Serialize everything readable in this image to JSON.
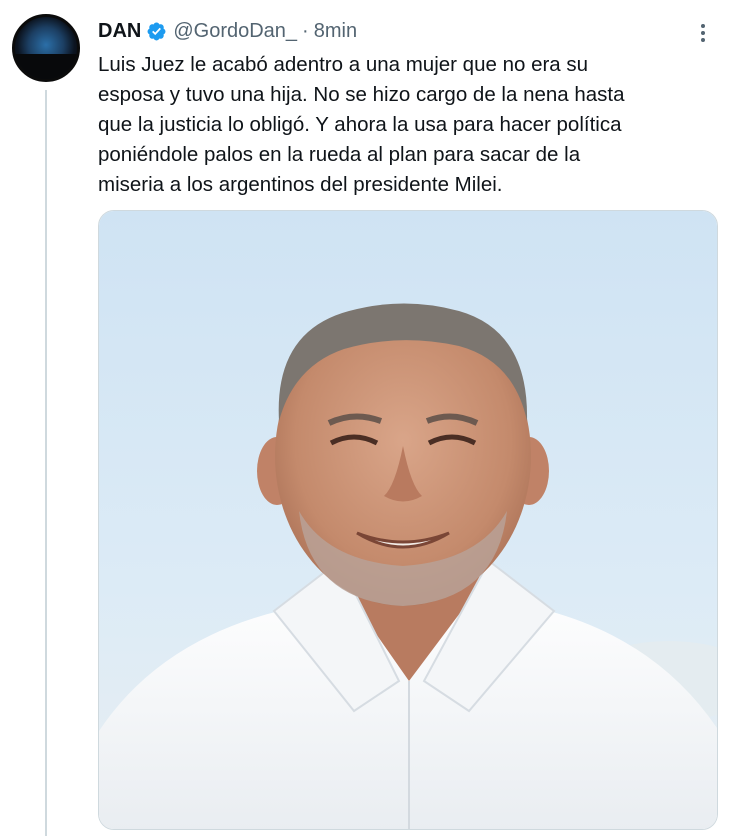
{
  "tweet": {
    "author_name": "DAN",
    "handle": "@GordoDan_",
    "separator": "·",
    "time": "8min",
    "text_lines": [
      "Luis Juez le acabó adentro a una mujer que no era su",
      "esposa y tuvo una hija. No se hizo cargo de la nena hasta",
      "que la justicia lo obligó. Y ahora la usa para hacer política",
      "poniéndole palos en la rueda al plan para sacar de la",
      "miseria a los argentinos del presidente Milei."
    ],
    "verified_icon": "verified-badge-icon",
    "more_icon": "more-options-icon",
    "media_description_icon": "photo"
  },
  "colors": {
    "verified": "#1d9bf0",
    "secondary_text": "#536471",
    "thread_line": "#cfd9de"
  }
}
